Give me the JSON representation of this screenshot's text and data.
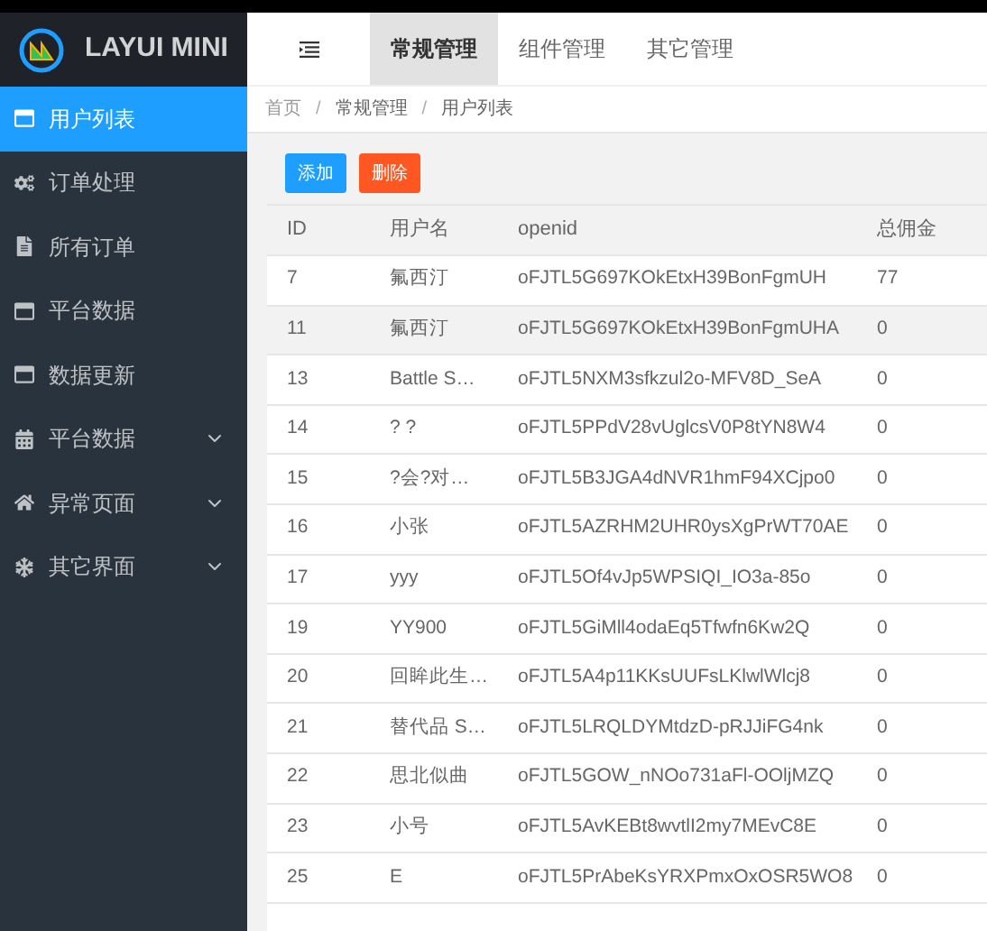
{
  "logo": {
    "title": "LAYUI MINI"
  },
  "top_nav": {
    "tabs": [
      {
        "label": "常规管理",
        "selected": true
      },
      {
        "label": "组件管理",
        "selected": false
      },
      {
        "label": "其它管理",
        "selected": false
      }
    ]
  },
  "sidebar": {
    "items": [
      {
        "label": "用户列表",
        "selected": true,
        "has_children": false
      },
      {
        "label": "订单处理",
        "selected": false,
        "has_children": false
      },
      {
        "label": "所有订单",
        "selected": false,
        "has_children": false
      },
      {
        "label": "平台数据",
        "selected": false,
        "has_children": false
      },
      {
        "label": "数据更新",
        "selected": false,
        "has_children": false
      },
      {
        "label": "平台数据",
        "selected": false,
        "has_children": true
      },
      {
        "label": "异常页面",
        "selected": false,
        "has_children": true
      },
      {
        "label": "其它界面",
        "selected": false,
        "has_children": true
      }
    ]
  },
  "breadcrumb": {
    "separator": "/",
    "items": [
      "首页",
      "常规管理",
      "用户列表"
    ]
  },
  "toolbar": {
    "buttons": [
      {
        "label": "添加",
        "kind": "primary"
      },
      {
        "label": "删除",
        "kind": "danger"
      }
    ]
  },
  "table": {
    "columns": [
      "ID",
      "用户名",
      "openid",
      "总佣金"
    ],
    "rows": [
      {
        "cells": [
          "7",
          "氟西汀",
          "oFJTL5G697KOkEtxH39BonFgmUH",
          "77"
        ],
        "selected": false
      },
      {
        "cells": [
          "11",
          "氟西汀",
          "oFJTL5G697KOkEtxH39BonFgmUHA",
          "0"
        ],
        "selected": true
      },
      {
        "cells": [
          "13",
          "Battle S…",
          "oFJTL5NXM3sfkzul2o-MFV8D_SeA",
          "0"
        ],
        "selected": false
      },
      {
        "cells": [
          "14",
          "? ?",
          "oFJTL5PPdV28vUglcsV0P8tYN8W4",
          "0"
        ],
        "selected": false
      },
      {
        "cells": [
          "15",
          "?会?对…",
          "oFJTL5B3JGA4dNVR1hmF94XCjpo0",
          "0"
        ],
        "selected": false
      },
      {
        "cells": [
          "16",
          "小张",
          "oFJTL5AZRHM2UHR0ysXgPrWT70AE",
          "0"
        ],
        "selected": false
      },
      {
        "cells": [
          "17",
          "yyy",
          "oFJTL5Of4vJp5WPSIQI_IO3a-85o",
          "0"
        ],
        "selected": false
      },
      {
        "cells": [
          "19",
          "YY900",
          "oFJTL5GiMll4odaEq5Tfwfn6Kw2Q",
          "0"
        ],
        "selected": false
      },
      {
        "cells": [
          "20",
          "回眸此生…",
          "oFJTL5A4p11KKsUUFsLKlwlWlcj8",
          "0"
        ],
        "selected": false
      },
      {
        "cells": [
          "21",
          "替代品 S…",
          "oFJTL5LRQLDYMtdzD-pRJJiFG4nk",
          "0"
        ],
        "selected": false
      },
      {
        "cells": [
          "22",
          "思北似曲",
          "oFJTL5GOW_nNOo731aFl-OOljMZQ",
          "0"
        ],
        "selected": false
      },
      {
        "cells": [
          "23",
          "小号",
          "oFJTL5AvKEBt8wvtlI2my7MEvC8E",
          "0"
        ],
        "selected": false
      },
      {
        "cells": [
          "25",
          "E",
          "oFJTL5PrAbeKsYRXPmxOxOSR5WO8",
          "0"
        ],
        "selected": false
      }
    ]
  }
}
